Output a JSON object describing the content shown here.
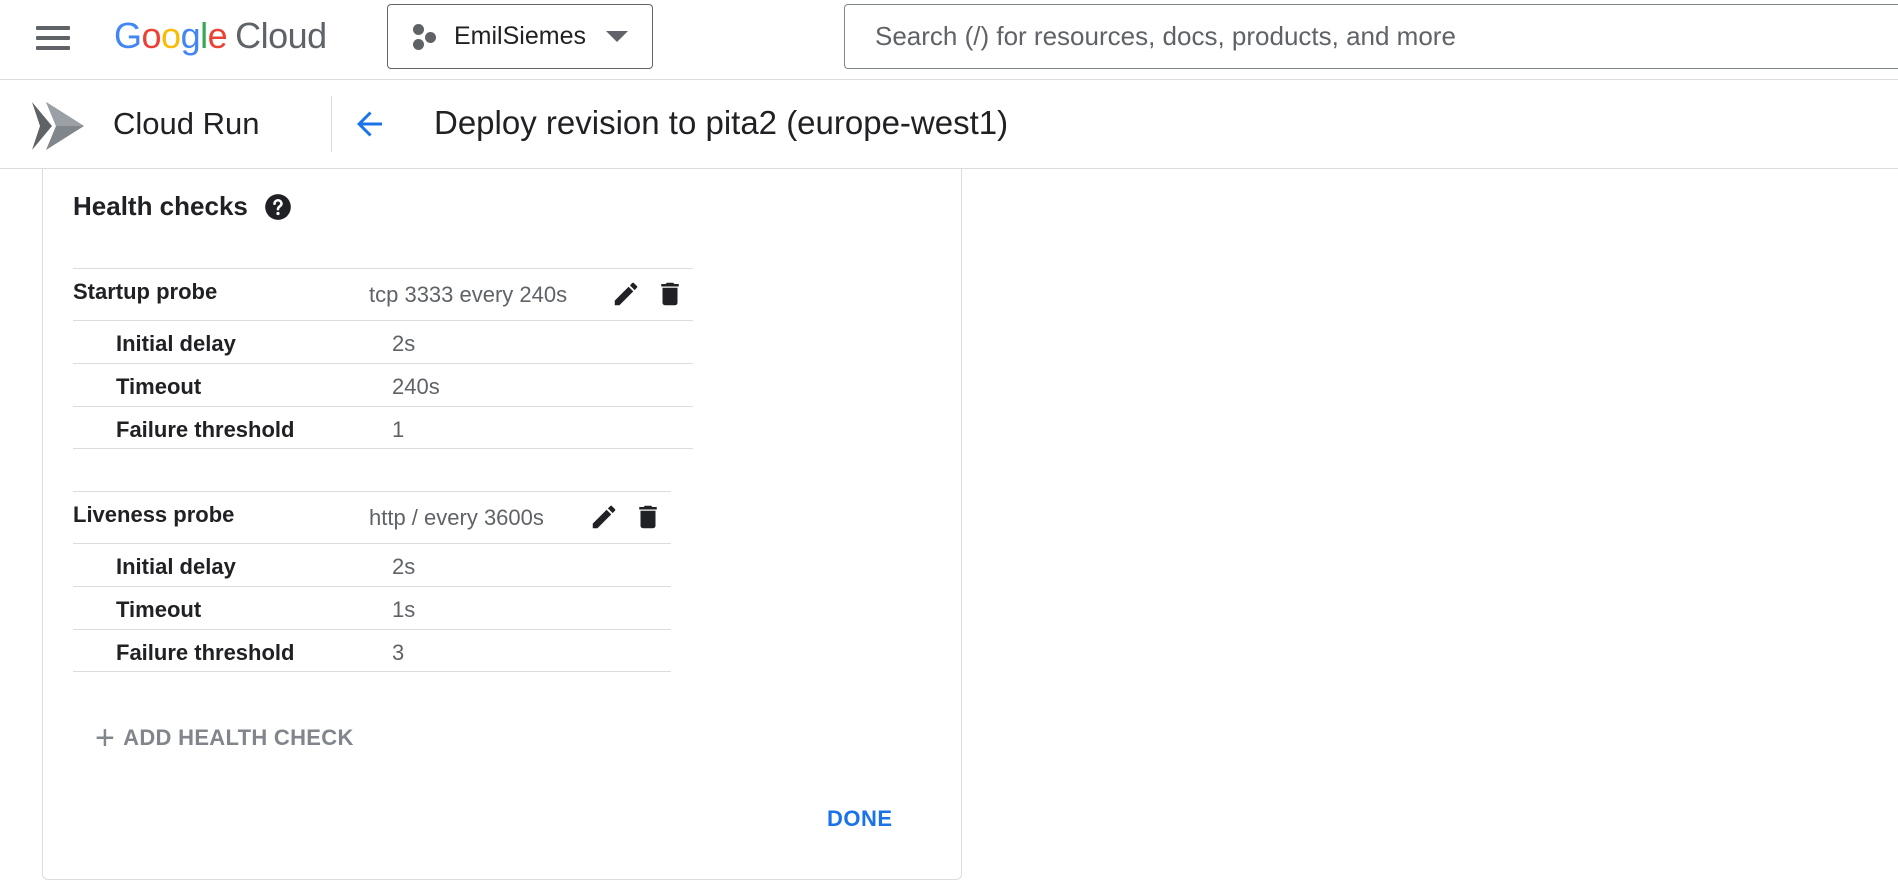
{
  "header": {
    "logo_google_letters": [
      "G",
      "o",
      "o",
      "g",
      "l",
      "e"
    ],
    "logo_cloud": "Cloud",
    "project_name": "EmilSiemes",
    "search_placeholder": "Search (/) for resources, docs, products, and more"
  },
  "subheader": {
    "product_title": "Cloud Run",
    "page_title": "Deploy revision to pita2 (europe-west1)"
  },
  "health_checks": {
    "title": "Health checks",
    "probes": [
      {
        "label": "Startup probe",
        "summary": "tcp 3333 every 240s",
        "rows": [
          {
            "label": "Initial delay",
            "value": "2s"
          },
          {
            "label": "Timeout",
            "value": "240s"
          },
          {
            "label": "Failure threshold",
            "value": "1"
          }
        ]
      },
      {
        "label": "Liveness probe",
        "summary": "http / every 3600s",
        "rows": [
          {
            "label": "Initial delay",
            "value": "2s"
          },
          {
            "label": "Timeout",
            "value": "1s"
          },
          {
            "label": "Failure threshold",
            "value": "3"
          }
        ]
      }
    ],
    "add_label": "ADD HEALTH CHECK",
    "add_icon": "+",
    "done_label": "DONE"
  },
  "colors": {
    "accent": "#1a73e8",
    "text_primary": "#202124",
    "text_secondary": "#5f6368",
    "divider": "#dadce0"
  },
  "icons": [
    "menu-icon",
    "project-icon",
    "chevron-down-icon",
    "cloud-run-icon",
    "back-arrow-icon",
    "help-icon",
    "edit-icon",
    "delete-icon",
    "plus-icon"
  ]
}
